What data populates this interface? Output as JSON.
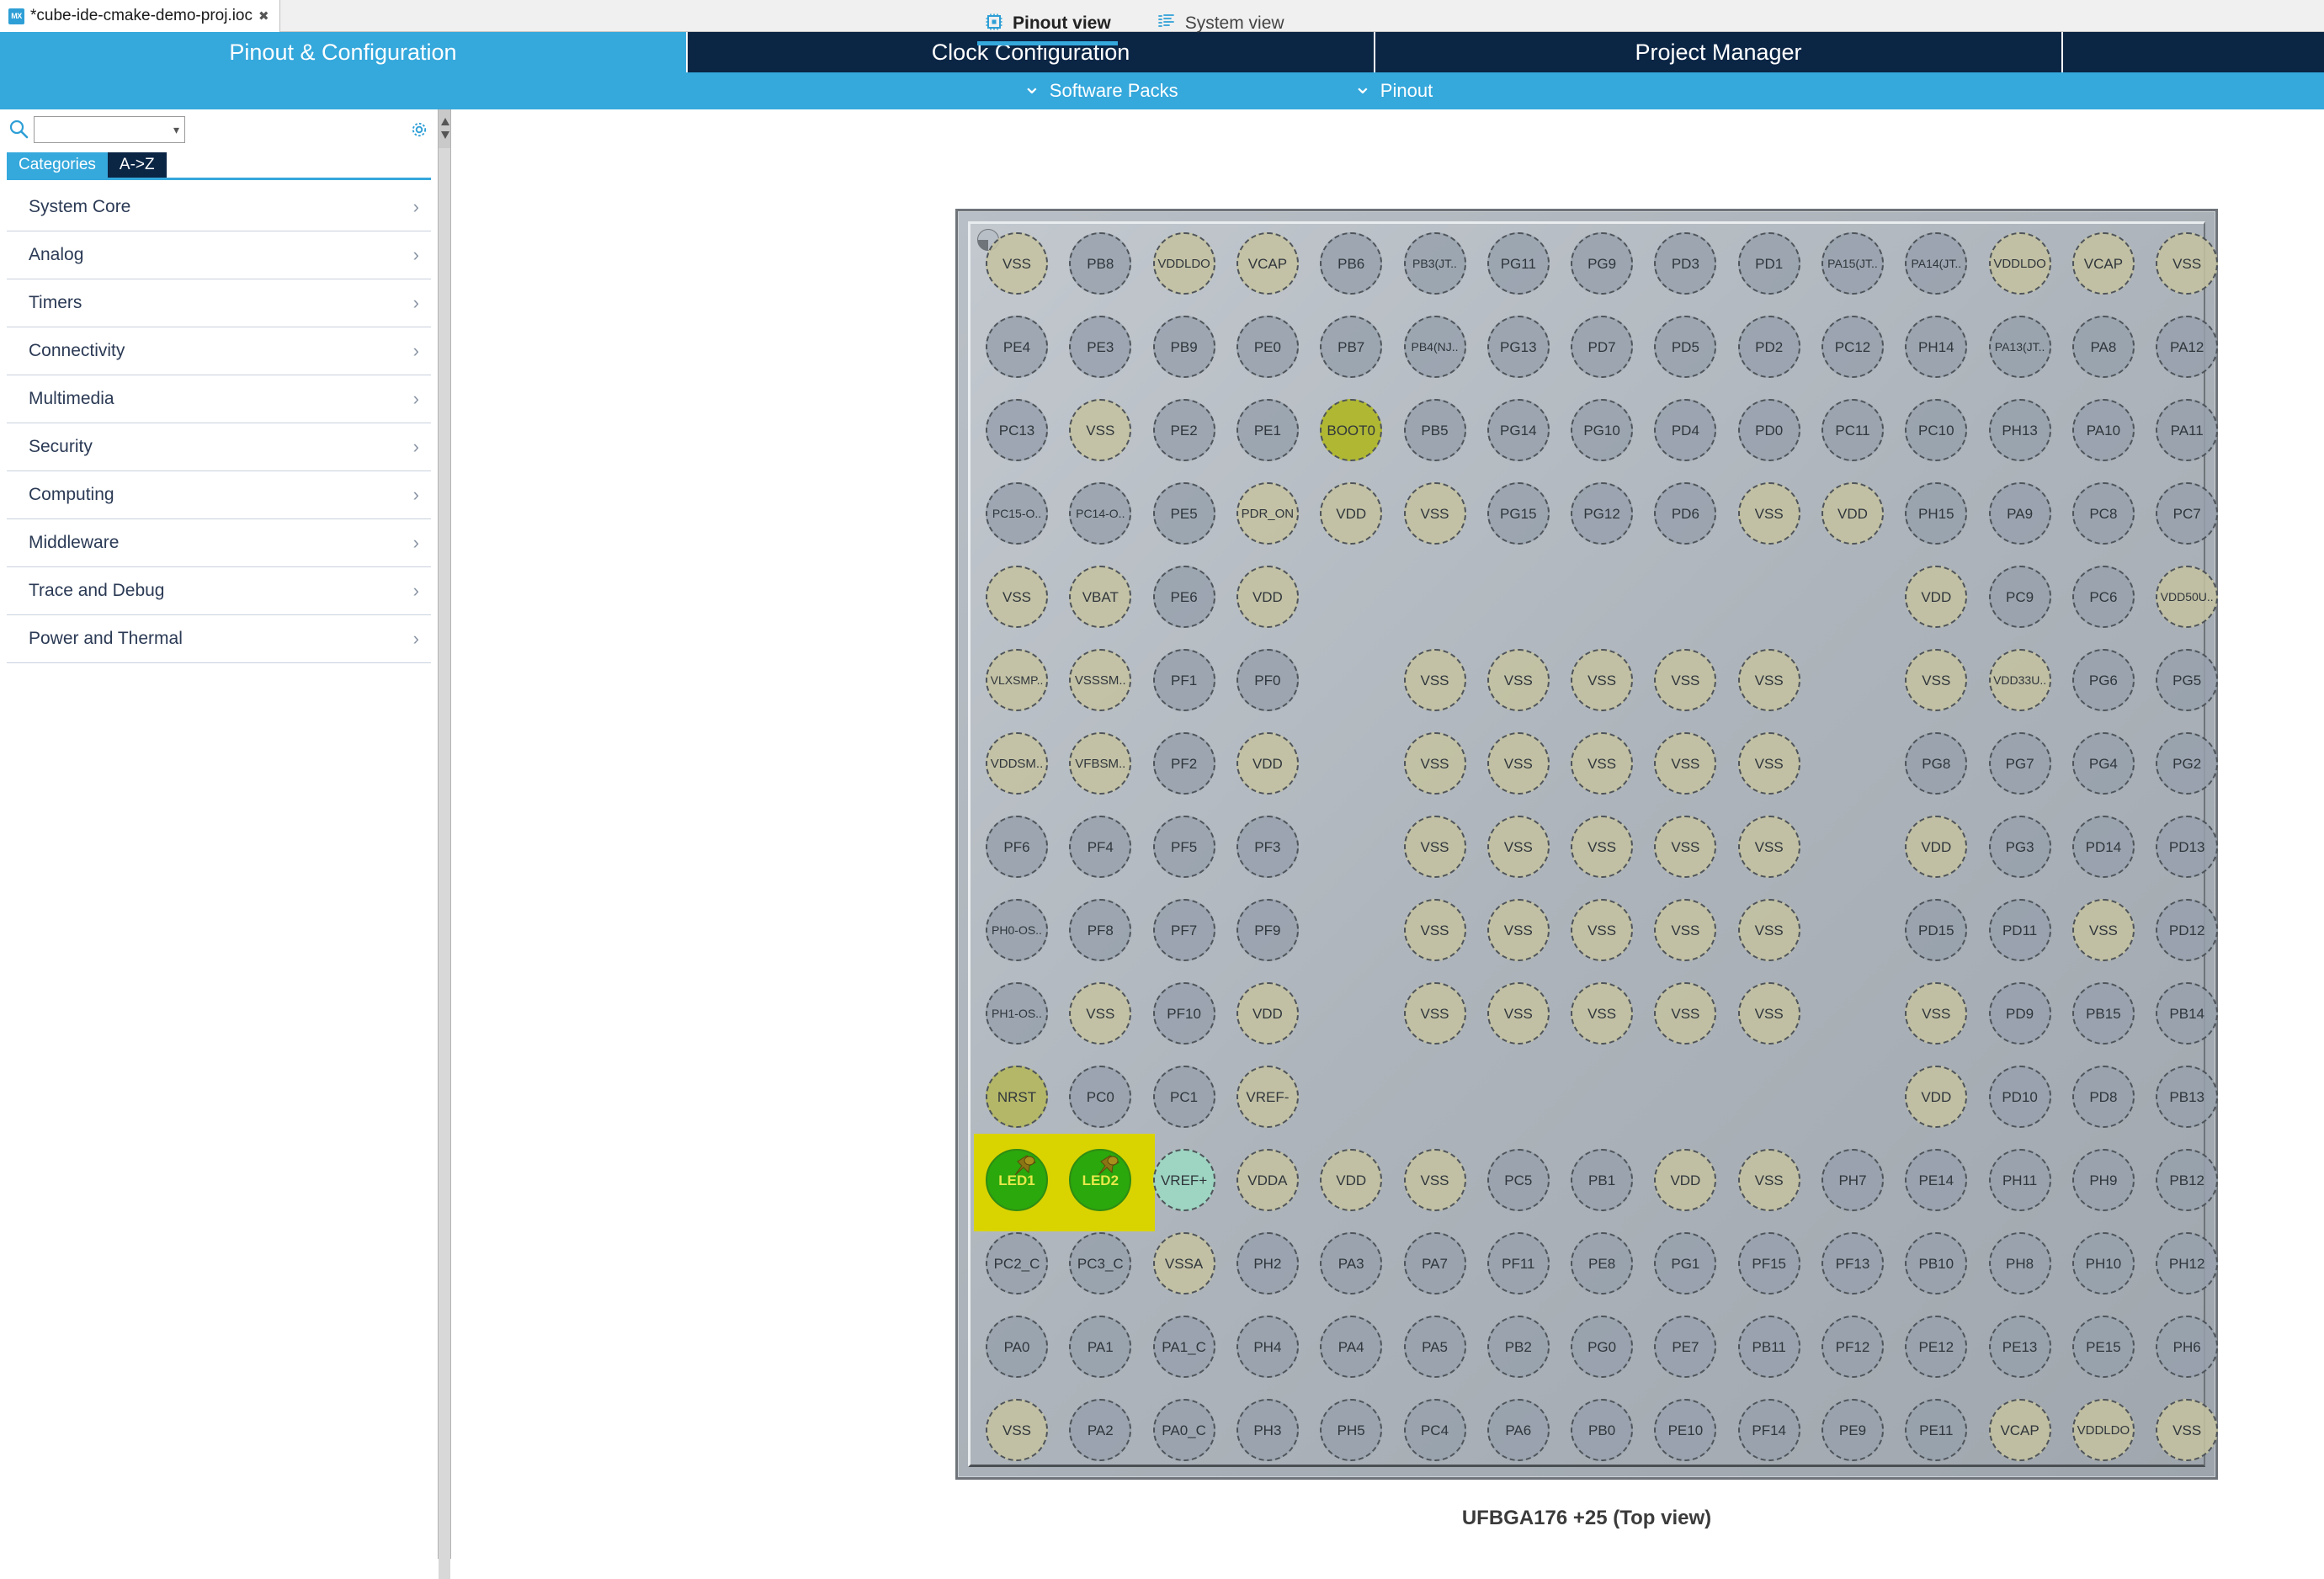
{
  "editor_tab": {
    "icon": "cubemx-icon",
    "title": "*cube-ide-cmake-demo-proj.ioc",
    "close": "✖"
  },
  "nav_tabs": [
    {
      "label": "Pinout & Configuration",
      "active": true
    },
    {
      "label": "Clock Configuration",
      "active": false
    },
    {
      "label": "Project Manager",
      "active": false
    },
    {
      "label": "",
      "active": false
    }
  ],
  "subbar": [
    {
      "label": "Software Packs",
      "icon": "chevron-down-icon"
    },
    {
      "label": "Pinout",
      "icon": "chevron-down-icon"
    }
  ],
  "sidebar": {
    "search": {
      "value": "",
      "placeholder": ""
    },
    "gear_tooltip": "gear-icon",
    "segments": [
      {
        "label": "Categories",
        "active": true
      },
      {
        "label": "A->Z",
        "active": false
      }
    ],
    "categories": [
      {
        "label": "System Core"
      },
      {
        "label": "Analog"
      },
      {
        "label": "Timers"
      },
      {
        "label": "Connectivity"
      },
      {
        "label": "Multimedia"
      },
      {
        "label": "Security"
      },
      {
        "label": "Computing"
      },
      {
        "label": "Middleware"
      },
      {
        "label": "Trace and Debug"
      },
      {
        "label": "Power and Thermal"
      }
    ]
  },
  "view_tabs": [
    {
      "label": "Pinout view",
      "icon": "chip-icon",
      "active": true
    },
    {
      "label": "System view",
      "icon": "list-icon",
      "active": false
    }
  ],
  "chip": {
    "caption": "UFBGA176 +25 (Top view)",
    "colors": {
      "io": "#96a0ac",
      "power": "#c4c2a0",
      "boot": "#b0b833",
      "reset": "#b4b768",
      "vref": "#9ed4c2",
      "led": "#2aa80c",
      "highlight": "#d9d400",
      "led_label": "#e7e84a"
    },
    "columns": 15,
    "rows": 15,
    "grid": [
      [
        {
          "l": "VSS",
          "t": "power"
        },
        {
          "l": "PB8",
          "t": "io"
        },
        {
          "l": "VDDLDO",
          "t": "power"
        },
        {
          "l": "VCAP",
          "t": "power"
        },
        {
          "l": "PB6",
          "t": "io"
        },
        {
          "l": "PB3(JT..",
          "t": "io"
        },
        {
          "l": "PG11",
          "t": "io"
        },
        {
          "l": "PG9",
          "t": "io"
        },
        {
          "l": "PD3",
          "t": "io"
        },
        {
          "l": "PD1",
          "t": "io"
        },
        {
          "l": "PA15(JT..",
          "t": "io"
        },
        {
          "l": "PA14(JT..",
          "t": "io"
        },
        {
          "l": "VDDLDO",
          "t": "power"
        },
        {
          "l": "VCAP",
          "t": "power"
        },
        {
          "l": "VSS",
          "t": "power"
        }
      ],
      [
        {
          "l": "PE4",
          "t": "io"
        },
        {
          "l": "PE3",
          "t": "io"
        },
        {
          "l": "PB9",
          "t": "io"
        },
        {
          "l": "PE0",
          "t": "io"
        },
        {
          "l": "PB7",
          "t": "io"
        },
        {
          "l": "PB4(NJ..",
          "t": "io"
        },
        {
          "l": "PG13",
          "t": "io"
        },
        {
          "l": "PD7",
          "t": "io"
        },
        {
          "l": "PD5",
          "t": "io"
        },
        {
          "l": "PD2",
          "t": "io"
        },
        {
          "l": "PC12",
          "t": "io"
        },
        {
          "l": "PH14",
          "t": "io"
        },
        {
          "l": "PA13(JT..",
          "t": "io"
        },
        {
          "l": "PA8",
          "t": "io"
        },
        {
          "l": "PA12",
          "t": "io"
        }
      ],
      [
        {
          "l": "PC13",
          "t": "io"
        },
        {
          "l": "VSS",
          "t": "power"
        },
        {
          "l": "PE2",
          "t": "io"
        },
        {
          "l": "PE1",
          "t": "io"
        },
        {
          "l": "BOOT0",
          "t": "boot"
        },
        {
          "l": "PB5",
          "t": "io"
        },
        {
          "l": "PG14",
          "t": "io"
        },
        {
          "l": "PG10",
          "t": "io"
        },
        {
          "l": "PD4",
          "t": "io"
        },
        {
          "l": "PD0",
          "t": "io"
        },
        {
          "l": "PC11",
          "t": "io"
        },
        {
          "l": "PC10",
          "t": "io"
        },
        {
          "l": "PH13",
          "t": "io"
        },
        {
          "l": "PA10",
          "t": "io"
        },
        {
          "l": "PA11",
          "t": "io"
        }
      ],
      [
        {
          "l": "PC15-O..",
          "t": "io"
        },
        {
          "l": "PC14-O..",
          "t": "io"
        },
        {
          "l": "PE5",
          "t": "io"
        },
        {
          "l": "PDR_ON",
          "t": "power"
        },
        {
          "l": "VDD",
          "t": "power"
        },
        {
          "l": "VSS",
          "t": "power"
        },
        {
          "l": "PG15",
          "t": "io"
        },
        {
          "l": "PG12",
          "t": "io"
        },
        {
          "l": "PD6",
          "t": "io"
        },
        {
          "l": "VSS",
          "t": "power"
        },
        {
          "l": "VDD",
          "t": "power"
        },
        {
          "l": "PH15",
          "t": "io"
        },
        {
          "l": "PA9",
          "t": "io"
        },
        {
          "l": "PC8",
          "t": "io"
        },
        {
          "l": "PC7",
          "t": "io"
        }
      ],
      [
        {
          "l": "VSS",
          "t": "power"
        },
        {
          "l": "VBAT",
          "t": "power"
        },
        {
          "l": "PE6",
          "t": "io"
        },
        {
          "l": "VDD",
          "t": "power"
        },
        {
          "l": "",
          "t": "empty"
        },
        {
          "l": "",
          "t": "empty"
        },
        {
          "l": "",
          "t": "empty"
        },
        {
          "l": "",
          "t": "empty"
        },
        {
          "l": "",
          "t": "empty"
        },
        {
          "l": "",
          "t": "empty"
        },
        {
          "l": "",
          "t": "empty"
        },
        {
          "l": "VDD",
          "t": "power"
        },
        {
          "l": "PC9",
          "t": "io"
        },
        {
          "l": "PC6",
          "t": "io"
        },
        {
          "l": "VDD50U..",
          "t": "power"
        }
      ],
      [
        {
          "l": "VLXSMP..",
          "t": "power"
        },
        {
          "l": "VSSSM..",
          "t": "power"
        },
        {
          "l": "PF1",
          "t": "io"
        },
        {
          "l": "PF0",
          "t": "io"
        },
        {
          "l": "",
          "t": "empty"
        },
        {
          "l": "VSS",
          "t": "power"
        },
        {
          "l": "VSS",
          "t": "power"
        },
        {
          "l": "VSS",
          "t": "power"
        },
        {
          "l": "VSS",
          "t": "power"
        },
        {
          "l": "VSS",
          "t": "power"
        },
        {
          "l": "",
          "t": "empty"
        },
        {
          "l": "VSS",
          "t": "power"
        },
        {
          "l": "VDD33U..",
          "t": "power"
        },
        {
          "l": "PG6",
          "t": "io"
        },
        {
          "l": "PG5",
          "t": "io"
        }
      ],
      [
        {
          "l": "VDDSM..",
          "t": "power"
        },
        {
          "l": "VFBSM..",
          "t": "power"
        },
        {
          "l": "PF2",
          "t": "io"
        },
        {
          "l": "VDD",
          "t": "power"
        },
        {
          "l": "",
          "t": "empty"
        },
        {
          "l": "VSS",
          "t": "power"
        },
        {
          "l": "VSS",
          "t": "power"
        },
        {
          "l": "VSS",
          "t": "power"
        },
        {
          "l": "VSS",
          "t": "power"
        },
        {
          "l": "VSS",
          "t": "power"
        },
        {
          "l": "",
          "t": "empty"
        },
        {
          "l": "PG8",
          "t": "io"
        },
        {
          "l": "PG7",
          "t": "io"
        },
        {
          "l": "PG4",
          "t": "io"
        },
        {
          "l": "PG2",
          "t": "io"
        }
      ],
      [
        {
          "l": "PF6",
          "t": "io"
        },
        {
          "l": "PF4",
          "t": "io"
        },
        {
          "l": "PF5",
          "t": "io"
        },
        {
          "l": "PF3",
          "t": "io"
        },
        {
          "l": "",
          "t": "empty"
        },
        {
          "l": "VSS",
          "t": "power"
        },
        {
          "l": "VSS",
          "t": "power"
        },
        {
          "l": "VSS",
          "t": "power"
        },
        {
          "l": "VSS",
          "t": "power"
        },
        {
          "l": "VSS",
          "t": "power"
        },
        {
          "l": "",
          "t": "empty"
        },
        {
          "l": "VDD",
          "t": "power"
        },
        {
          "l": "PG3",
          "t": "io"
        },
        {
          "l": "PD14",
          "t": "io"
        },
        {
          "l": "PD13",
          "t": "io"
        }
      ],
      [
        {
          "l": "PH0-OS..",
          "t": "io"
        },
        {
          "l": "PF8",
          "t": "io"
        },
        {
          "l": "PF7",
          "t": "io"
        },
        {
          "l": "PF9",
          "t": "io"
        },
        {
          "l": "",
          "t": "empty"
        },
        {
          "l": "VSS",
          "t": "power"
        },
        {
          "l": "VSS",
          "t": "power"
        },
        {
          "l": "VSS",
          "t": "power"
        },
        {
          "l": "VSS",
          "t": "power"
        },
        {
          "l": "VSS",
          "t": "power"
        },
        {
          "l": "",
          "t": "empty"
        },
        {
          "l": "PD15",
          "t": "io"
        },
        {
          "l": "PD11",
          "t": "io"
        },
        {
          "l": "VSS",
          "t": "power"
        },
        {
          "l": "PD12",
          "t": "io"
        }
      ],
      [
        {
          "l": "PH1-OS..",
          "t": "io"
        },
        {
          "l": "VSS",
          "t": "power"
        },
        {
          "l": "PF10",
          "t": "io"
        },
        {
          "l": "VDD",
          "t": "power"
        },
        {
          "l": "",
          "t": "empty"
        },
        {
          "l": "VSS",
          "t": "power"
        },
        {
          "l": "VSS",
          "t": "power"
        },
        {
          "l": "VSS",
          "t": "power"
        },
        {
          "l": "VSS",
          "t": "power"
        },
        {
          "l": "VSS",
          "t": "power"
        },
        {
          "l": "",
          "t": "empty"
        },
        {
          "l": "VSS",
          "t": "power"
        },
        {
          "l": "PD9",
          "t": "io"
        },
        {
          "l": "PB15",
          "t": "io"
        },
        {
          "l": "PB14",
          "t": "io"
        }
      ],
      [
        {
          "l": "NRST",
          "t": "reset"
        },
        {
          "l": "PC0",
          "t": "io"
        },
        {
          "l": "PC1",
          "t": "io"
        },
        {
          "l": "VREF-",
          "t": "power"
        },
        {
          "l": "",
          "t": "empty"
        },
        {
          "l": "",
          "t": "empty"
        },
        {
          "l": "",
          "t": "empty"
        },
        {
          "l": "",
          "t": "empty"
        },
        {
          "l": "",
          "t": "empty"
        },
        {
          "l": "",
          "t": "empty"
        },
        {
          "l": "",
          "t": "empty"
        },
        {
          "l": "VDD",
          "t": "power"
        },
        {
          "l": "PD10",
          "t": "io"
        },
        {
          "l": "PD8",
          "t": "io"
        },
        {
          "l": "PB13",
          "t": "io"
        }
      ],
      [
        {
          "l": "LED1",
          "t": "led"
        },
        {
          "l": "LED2",
          "t": "led"
        },
        {
          "l": "VREF+",
          "t": "vref"
        },
        {
          "l": "VDDA",
          "t": "power"
        },
        {
          "l": "VDD",
          "t": "power"
        },
        {
          "l": "VSS",
          "t": "power"
        },
        {
          "l": "PC5",
          "t": "io"
        },
        {
          "l": "PB1",
          "t": "io"
        },
        {
          "l": "VDD",
          "t": "power"
        },
        {
          "l": "VSS",
          "t": "power"
        },
        {
          "l": "PH7",
          "t": "io"
        },
        {
          "l": "PE14",
          "t": "io"
        },
        {
          "l": "PH11",
          "t": "io"
        },
        {
          "l": "PH9",
          "t": "io"
        },
        {
          "l": "PB12",
          "t": "io"
        }
      ],
      [
        {
          "l": "PC2_C",
          "t": "io"
        },
        {
          "l": "PC3_C",
          "t": "io"
        },
        {
          "l": "VSSA",
          "t": "power"
        },
        {
          "l": "PH2",
          "t": "io"
        },
        {
          "l": "PA3",
          "t": "io"
        },
        {
          "l": "PA7",
          "t": "io"
        },
        {
          "l": "PF11",
          "t": "io"
        },
        {
          "l": "PE8",
          "t": "io"
        },
        {
          "l": "PG1",
          "t": "io"
        },
        {
          "l": "PF15",
          "t": "io"
        },
        {
          "l": "PF13",
          "t": "io"
        },
        {
          "l": "PB10",
          "t": "io"
        },
        {
          "l": "PH8",
          "t": "io"
        },
        {
          "l": "PH10",
          "t": "io"
        },
        {
          "l": "PH12",
          "t": "io"
        }
      ],
      [
        {
          "l": "PA0",
          "t": "io"
        },
        {
          "l": "PA1",
          "t": "io"
        },
        {
          "l": "PA1_C",
          "t": "io"
        },
        {
          "l": "PH4",
          "t": "io"
        },
        {
          "l": "PA4",
          "t": "io"
        },
        {
          "l": "PA5",
          "t": "io"
        },
        {
          "l": "PB2",
          "t": "io"
        },
        {
          "l": "PG0",
          "t": "io"
        },
        {
          "l": "PE7",
          "t": "io"
        },
        {
          "l": "PB11",
          "t": "io"
        },
        {
          "l": "PF12",
          "t": "io"
        },
        {
          "l": "PE12",
          "t": "io"
        },
        {
          "l": "PE13",
          "t": "io"
        },
        {
          "l": "PE15",
          "t": "io"
        },
        {
          "l": "PH6",
          "t": "io"
        }
      ],
      [
        {
          "l": "VSS",
          "t": "power"
        },
        {
          "l": "PA2",
          "t": "io"
        },
        {
          "l": "PA0_C",
          "t": "io"
        },
        {
          "l": "PH3",
          "t": "io"
        },
        {
          "l": "PH5",
          "t": "io"
        },
        {
          "l": "PC4",
          "t": "io"
        },
        {
          "l": "PA6",
          "t": "io"
        },
        {
          "l": "PB0",
          "t": "io"
        },
        {
          "l": "PE10",
          "t": "io"
        },
        {
          "l": "PF14",
          "t": "io"
        },
        {
          "l": "PE9",
          "t": "io"
        },
        {
          "l": "PE11",
          "t": "io"
        },
        {
          "l": "VCAP",
          "t": "power"
        },
        {
          "l": "VDDLDO",
          "t": "power"
        },
        {
          "l": "VSS",
          "t": "power"
        }
      ]
    ]
  }
}
